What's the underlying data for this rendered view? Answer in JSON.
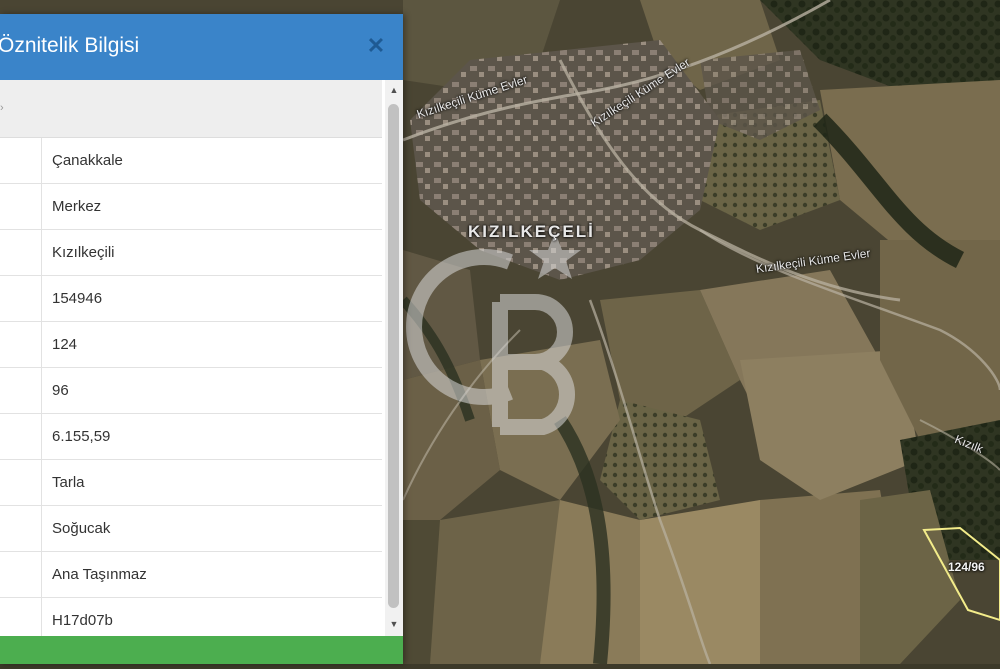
{
  "panel": {
    "title": "Öznitelik Bilgisi",
    "close_icon": "close-icon",
    "rows": [
      {
        "value": "Çanakkale"
      },
      {
        "value": "Merkez"
      },
      {
        "value": "Kızılkeçili"
      },
      {
        "value": "154946"
      },
      {
        "value": "124"
      },
      {
        "value": "96"
      },
      {
        "value": "6.155,59"
      },
      {
        "value": "Tarla"
      },
      {
        "value": "Soğucak"
      },
      {
        "value": "Ana Taşınmaz"
      },
      {
        "value": "H17d07b"
      }
    ]
  },
  "map": {
    "road_label_1": "Kızılkeçili Küme Evler",
    "road_label_2": "Kızılkeçili Küme Evler",
    "road_label_3": "Kızılkeçili Küme Evler",
    "road_label_4": "Kızılk",
    "village_label": "KIZILKEÇELİ",
    "parcel_label": "124/96",
    "watermark_logo": "cb-logo-watermark"
  },
  "colors": {
    "header": "#3a84c9",
    "footer": "#4cae4f",
    "parcel_outline": "#f3ec8a"
  }
}
